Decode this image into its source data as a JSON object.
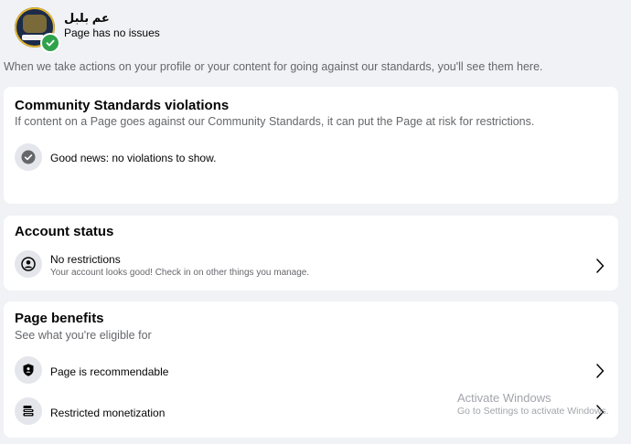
{
  "header": {
    "page_name": "عم بلبل",
    "status": "Page has no issues"
  },
  "intro_text": "When we take actions on your profile or your content for going against our standards, you'll see them here.",
  "violations": {
    "title": "Community Standards violations",
    "subtitle": "If content on a Page goes against our Community Standards, it can put the Page at risk for restrictions.",
    "message": "Good news: no violations to show."
  },
  "account_status": {
    "title": "Account status",
    "row_label": "No restrictions",
    "row_sub": "Your account looks good! Check in on other things you manage."
  },
  "page_benefits": {
    "title": "Page benefits",
    "subtitle": "See what you're eligible for",
    "items": [
      {
        "label": "Page is recommendable",
        "icon": "shield-icon"
      },
      {
        "label": "Restricted monetization",
        "icon": "money-icon"
      }
    ]
  },
  "watermark": {
    "line1": "Activate Windows",
    "line2": "Go to Settings to activate Windows."
  },
  "colors": {
    "background": "#f0f2f5",
    "card": "#ffffff",
    "success": "#31a24c",
    "secondary_text": "#65676b"
  }
}
